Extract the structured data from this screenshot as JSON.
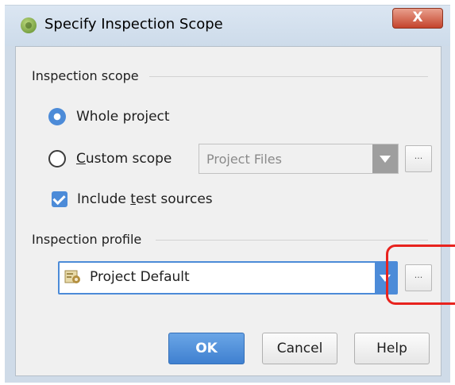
{
  "window": {
    "title": "Specify Inspection Scope",
    "close_label": "X"
  },
  "scope": {
    "section_label": "Inspection scope",
    "whole_project": {
      "label": "Whole project",
      "selected": true
    },
    "custom_scope": {
      "label_mnemonic": "C",
      "label_rest": "ustom scope",
      "selected": false,
      "combo_value": "Project Files",
      "browse_label": "..."
    },
    "include_tests": {
      "label_before": "Include ",
      "label_mnemonic": "t",
      "label_after": "est sources",
      "checked": true
    }
  },
  "profile": {
    "section_label": "Inspection profile",
    "combo_value": "Project Default",
    "browse_label": "..."
  },
  "buttons": {
    "ok": "OK",
    "cancel": "Cancel",
    "help": "Help"
  },
  "colors": {
    "accent": "#4c8bd8",
    "highlight": "#e8231e"
  }
}
